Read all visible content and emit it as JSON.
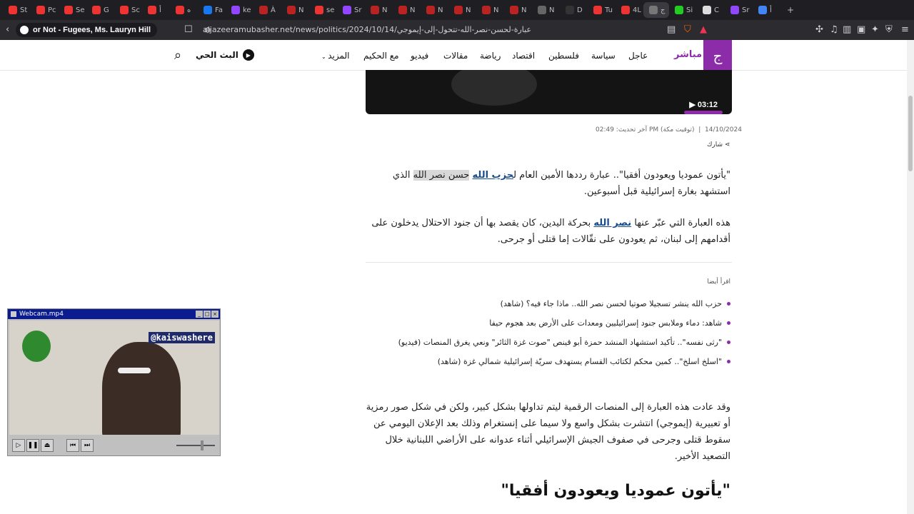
{
  "browser": {
    "tabs": [
      {
        "label": "St",
        "color": "#e33"
      },
      {
        "label": "Pc",
        "color": "#e33"
      },
      {
        "label": "Se",
        "color": "#e33"
      },
      {
        "label": "G",
        "color": "#e33"
      },
      {
        "label": "Sc",
        "color": "#e33"
      },
      {
        "label": "أ",
        "color": "#e33"
      },
      {
        "label": "ه",
        "color": "#e33"
      },
      {
        "label": "Fa",
        "color": "#1877f2"
      },
      {
        "label": "ke",
        "color": "#9146ff"
      },
      {
        "label": "À",
        "color": "#b22"
      },
      {
        "label": "N",
        "color": "#b22"
      },
      {
        "label": "se",
        "color": "#e33"
      },
      {
        "label": "Sr",
        "color": "#9146ff"
      },
      {
        "label": "N",
        "color": "#b22"
      },
      {
        "label": "N",
        "color": "#b22"
      },
      {
        "label": "N",
        "color": "#b22"
      },
      {
        "label": "N",
        "color": "#b22"
      },
      {
        "label": "N",
        "color": "#b22"
      },
      {
        "label": "N",
        "color": "#b22"
      },
      {
        "label": "N",
        "color": "#666"
      },
      {
        "label": "D",
        "color": "#333"
      },
      {
        "label": "Tu",
        "color": "#e33"
      },
      {
        "label": "4L",
        "color": "#e33"
      },
      {
        "label": "ج",
        "color": "#777"
      },
      {
        "label": "Si",
        "color": "#2c2"
      },
      {
        "label": "C",
        "color": "#ddd"
      },
      {
        "label": "Sr",
        "color": "#9146ff"
      },
      {
        "label": "أ",
        "color": "#4285f4"
      }
    ],
    "active_tab_close": "×",
    "new_tab": "+",
    "media_pill": "or Not - Fugees, Ms. Lauryn Hill",
    "url": "aljazeeramubasher.net/news/politics/2024/10/14/عبارة-لحسن-نصر-الله-تتحول-إلى-إيموجي"
  },
  "site": {
    "brand": "مباشر",
    "logo_glyph": "ج",
    "nav": [
      "عاجل",
      "سياسة",
      "فلسطين",
      "اقتصاد",
      "رياضة",
      "مقالات",
      "فيديو",
      "مع الحكيم",
      "المزيد"
    ],
    "live_label": "البث الحي"
  },
  "video": {
    "duration": "03:12"
  },
  "article": {
    "date": "14/10/2024",
    "updated": "آخر تحديث: 02:49 PM (توقيت مكة)",
    "share": "شارك",
    "p1_a": "\"يأتون عموديا ويعودون أفقيا\".. عبارة رددها الأمين العام ل",
    "p1_link": "حزب الله",
    "p1_hl": "حسن نصر الله",
    "p1_b": " الذي استشهد بغارة إسرائيلية قبل أسبوعين.",
    "p2_a": "هذه العبارة التي عبّر عنها ",
    "p2_link": "نصر الله",
    "p2_b": " بحركة اليدين، كان يقصد بها أن جنود الاحتلال يدخلون على أقدامهم إلى لبنان، ثم يعودون على نقّالات إما قتلى أو جرحى.",
    "read_also": "اقرأ أيضا",
    "related": [
      "حزب الله ينشر تسجيلا صوتيا لحسن نصر الله.. ماذا جاء فيه؟ (شاهد)",
      "شاهد: دماء وملابس جنود إسرائيليين ومعدات على الأرض بعد هجوم حيفا",
      "\"رثى نفسه\".. تأكيد استشهاد المنشد حمزة أبو قينص \"صوت غزة الثائر\" ونعي يغرق المنصات (فيديو)",
      "\"اسلخ اسلخ\".. كمين محكم لكتائب القسام يستهدف سريّة إسرائيلية شمالي غزة (شاهد)"
    ],
    "p3": "وقد عادت هذه العبارة إلى المنصات الرقمية ليتم تداولها بشكل كبير، ولكن في شكل صور رمزية أو تعبيرية (إيموجي) انتشرت بشكل واسع ولا سيما على إنستغرام وذلك بعد الإعلان اليومي عن سقوط قتلى وجرحى في صفوف الجيش الإسرائيلي أثناء عدوانه على الأراضي اللبنانية خلال التصعيد الأخير.",
    "h2": "\"يأتون عموديا ويعودون أفقيا\""
  },
  "webcam": {
    "title": "Webcam.mp4",
    "tag": "@kaiswashere"
  }
}
